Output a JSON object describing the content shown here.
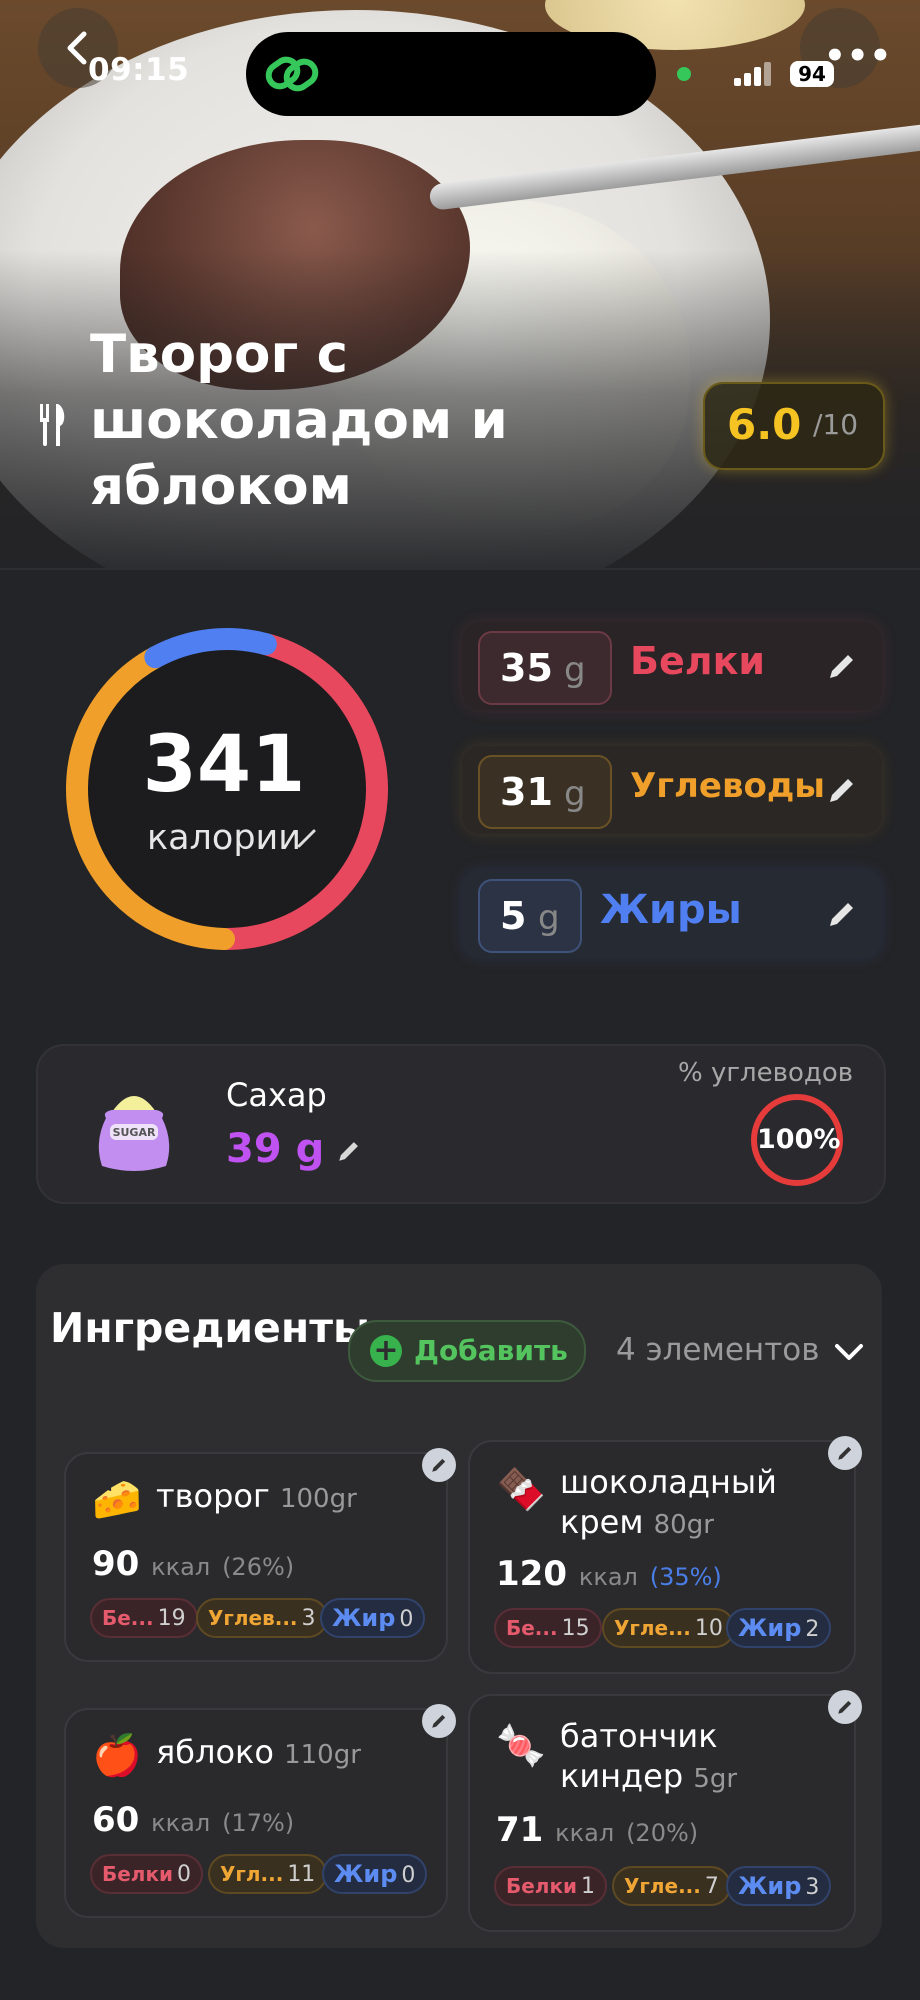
{
  "status_bar": {
    "time": "09:15",
    "battery": "94"
  },
  "meal": {
    "title": "Творог с шоколадом и яблоком",
    "score": "6.0",
    "score_max": "/10"
  },
  "calories": {
    "value": "341",
    "label": "калории"
  },
  "macros": {
    "protein": {
      "value": "35",
      "unit": "g",
      "label": "Белки",
      "color": "#e8485e"
    },
    "carbs": {
      "value": "31",
      "unit": "g",
      "label": "Углеводы",
      "color": "#f0a02a"
    },
    "fat": {
      "value": "5",
      "unit": "g",
      "label": "Жиры",
      "color": "#4f7ff0"
    }
  },
  "sugar": {
    "label": "Сахар",
    "value": "39 g",
    "pct_label": "% углеводов",
    "pct": "100%",
    "icon": "sugar-bag-icon"
  },
  "ingredients": {
    "title": "Ингредиенты",
    "add_label": "Добавить",
    "count_label": "4 элементов",
    "items": [
      {
        "icon": "🧀",
        "name": "творог",
        "grams": "100gr",
        "kcal": "90",
        "kcal_unit": "ккал",
        "pct": "(26%)",
        "protein_label": "Бе...",
        "protein": "19",
        "carbs_label": "Углев...",
        "carbs": "3",
        "fat_label": "Жир",
        "fat": "0"
      },
      {
        "icon": "🍫",
        "name": "шоколадный крем",
        "grams": "80gr",
        "kcal": "120",
        "kcal_unit": "ккал",
        "pct": "(35%)",
        "protein_label": "Бе...",
        "protein": "15",
        "carbs_label": "Угле...",
        "carbs": "10",
        "fat_label": "Жир",
        "fat": "2"
      },
      {
        "icon": "🍎",
        "name": "яблоко",
        "grams": "110gr",
        "kcal": "60",
        "kcal_unit": "ккал",
        "pct": "(17%)",
        "protein_label": "Белки",
        "protein": "0",
        "carbs_label": "Угл...",
        "carbs": "11",
        "fat_label": "Жир",
        "fat": "0"
      },
      {
        "icon": "🍬",
        "name": "батончик киндер",
        "grams": "5gr",
        "kcal": "71",
        "kcal_unit": "ккал",
        "pct": "(20%)",
        "protein_label": "Белки",
        "protein": "1",
        "carbs_label": "Угле...",
        "carbs": "7",
        "fat_label": "Жир",
        "fat": "3"
      }
    ]
  },
  "calorie_split": {
    "protein_fraction": 0.42,
    "carbs_fraction": 0.38,
    "fat_fraction": 0.11
  }
}
